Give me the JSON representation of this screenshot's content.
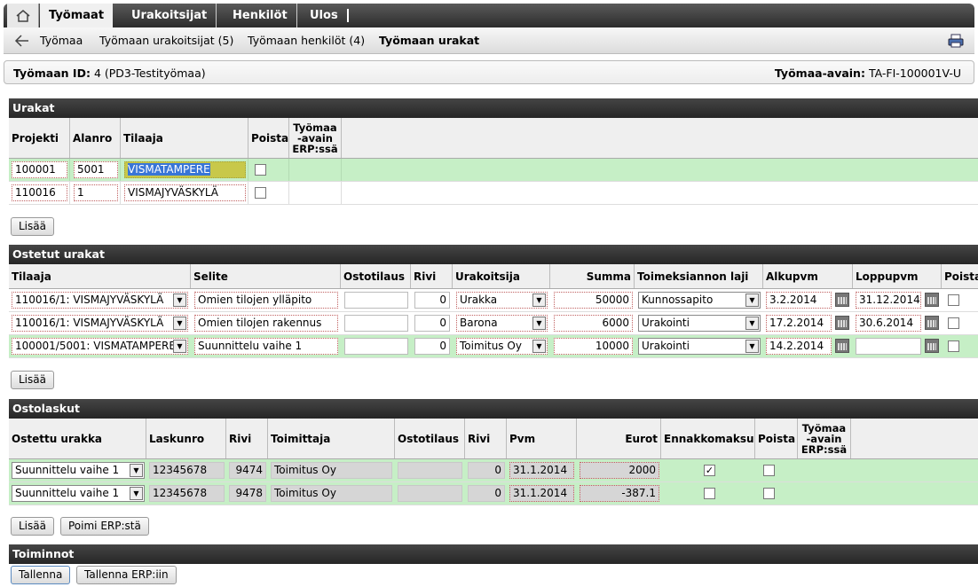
{
  "nav": {
    "tabs": [
      "Työmaat",
      "Urakoitsijat",
      "Henkilöt",
      "Ulos"
    ],
    "active_tab": "Työmaat"
  },
  "subnav": {
    "items": [
      "Työmaa",
      "Työmaan urakoitsijat (5)",
      "Työmaan henkilöt (4)",
      "Työmaan urakat"
    ],
    "active": "Työmaan urakat"
  },
  "idbar": {
    "left_label": "Työmaan ID:",
    "left_value": "4 (PD3-Testityömaa)",
    "right_label": "Työmaa-avain:",
    "right_value": "TA-FI-100001V-U"
  },
  "urakat": {
    "title": "Urakat",
    "headers": [
      "Projekti",
      "Alanro",
      "Tilaaja",
      "Poista",
      "Työmaa -avain ERP:ssä"
    ],
    "rows": [
      {
        "projekti": "100001",
        "alanro": "5001",
        "tilaaja": "VISMATAMPERE",
        "poista": false,
        "highlight": true
      },
      {
        "projekti": "110016",
        "alanro": "1",
        "tilaaja": "VISMAJYVÄSKYLÄ",
        "poista": false,
        "highlight": false
      }
    ],
    "add_button": "Lisää"
  },
  "ostetut": {
    "title": "Ostetut urakat",
    "headers": [
      "Tilaaja",
      "Selite",
      "Ostotilaus",
      "Rivi",
      "Urakoitsija",
      "Summa",
      "Toimeksiannon laji",
      "Alkupvm",
      "Loppupvm",
      "Poista"
    ],
    "rows": [
      {
        "tilaaja": "110016/1: VISMAJYVÄSKYLÄ",
        "selite": "Omien tilojen ylläpito",
        "ostotilaus": "",
        "rivi": "0",
        "urakoitsija": "Urakka",
        "summa": "50000",
        "laji": "Kunnossapito",
        "alku": "3.2.2014",
        "loppu": "31.12.2014",
        "poista": false,
        "highlight": false
      },
      {
        "tilaaja": "110016/1: VISMAJYVÄSKYLÄ",
        "selite": "Omien tilojen rakennus",
        "ostotilaus": "",
        "rivi": "0",
        "urakoitsija": "Barona",
        "summa": "6000",
        "laji": "Urakointi",
        "alku": "17.2.2014",
        "loppu": "30.6.2014",
        "poista": false,
        "highlight": false
      },
      {
        "tilaaja": "100001/5001: VISMATAMPERE",
        "selite": "Suunnittelu vaihe 1",
        "ostotilaus": "",
        "rivi": "0",
        "urakoitsija": "Toimitus Oy",
        "summa": "10000",
        "laji": "Urakointi",
        "alku": "14.2.2014",
        "loppu": "",
        "poista": false,
        "highlight": true
      }
    ],
    "add_button": "Lisää"
  },
  "ostolaskut": {
    "title": "Ostolaskut",
    "headers": [
      "Ostettu urakka",
      "Laskunro",
      "Rivi",
      "Toimittaja",
      "Ostotilaus",
      "Rivi",
      "Pvm",
      "Eurot",
      "Ennakkomaksu",
      "Poista",
      "Työmaa -avain ERP:ssä"
    ],
    "rows": [
      {
        "urakka": "Suunnittelu vaihe 1",
        "laskunro": "12345678",
        "rivi": "9474",
        "toimittaja": "Toimitus Oy",
        "ostotilaus": "",
        "rivi2": "0",
        "pvm": "31.1.2014",
        "eurot": "2000",
        "ennakko": true,
        "poista": false
      },
      {
        "urakka": "Suunnittelu vaihe 1",
        "laskunro": "12345678",
        "rivi": "9478",
        "toimittaja": "Toimitus Oy",
        "ostotilaus": "",
        "rivi2": "0",
        "pvm": "31.1.2014",
        "eurot": "-387.1",
        "ennakko": false,
        "poista": false
      }
    ],
    "add_button": "Lisää",
    "fetch_button": "Poimi ERP:stä"
  },
  "toiminnot": {
    "title": "Toiminnot",
    "save_button": "Tallenna",
    "save_erp_button": "Tallenna ERP:iin"
  },
  "icons": {
    "home": "home-icon",
    "back": "back-arrow-icon",
    "print": "printer-icon",
    "calendar": "calendar-icon",
    "dropdown": "chevron-down-icon"
  }
}
